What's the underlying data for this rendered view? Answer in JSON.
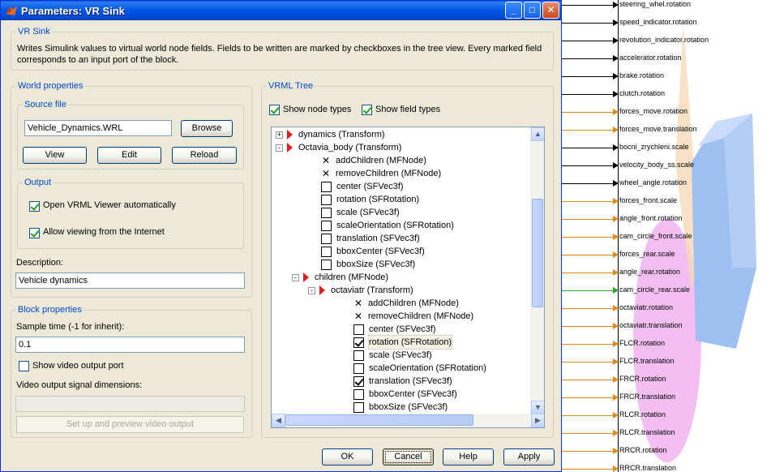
{
  "window": {
    "title": "Parameters: VR Sink",
    "minimize_label": "_",
    "maximize_label": "□",
    "close_label": "✕"
  },
  "vr_sink": {
    "heading": "VR Sink",
    "description": "Writes Simulink values to virtual world node fields. Fields to be written are marked by checkboxes in the tree view. Every marked field corresponds to an input port of the block."
  },
  "world_properties": {
    "heading": "World properties",
    "source_file": {
      "heading": "Source file",
      "value": "Vehicle_Dynamics.WRL",
      "browse_label": "Browse",
      "view_label": "View",
      "edit_label": "Edit",
      "reload_label": "Reload"
    },
    "output": {
      "heading": "Output",
      "open_viewer_label": "Open VRML Viewer automatically",
      "open_viewer_checked": true,
      "allow_internet_label": "Allow viewing from the Internet",
      "allow_internet_checked": true
    },
    "description_label": "Description:",
    "description_value": "Vehicle dynamics"
  },
  "block_properties": {
    "heading": "Block properties",
    "sample_time_label": "Sample time (-1 for inherit):",
    "sample_time_value": "0.1",
    "show_video_label": "Show video output port",
    "show_video_checked": false,
    "video_dims_label": "Video output signal dimensions:",
    "video_dims_value": "",
    "setup_video_label": "Set up and preview video output"
  },
  "vrml_tree": {
    "heading": "VRML Tree",
    "show_node_types_label": "Show node types",
    "show_node_types_checked": true,
    "show_field_types_label": "Show field types",
    "show_field_types_checked": true,
    "rows": [
      {
        "label": "dynamics (Transform)",
        "kind": "node",
        "level": 0,
        "expander": "+"
      },
      {
        "label": "Octavia_body (Transform)",
        "kind": "node",
        "level": 0,
        "expander": "-"
      },
      {
        "label": "addChildren (MFNode)",
        "kind": "x",
        "level": 1
      },
      {
        "label": "removeChildren (MFNode)",
        "kind": "x",
        "level": 1
      },
      {
        "label": "center (SFVec3f)",
        "kind": "cb",
        "level": 1,
        "checked": false
      },
      {
        "label": "rotation (SFRotation)",
        "kind": "cb",
        "level": 1,
        "checked": false
      },
      {
        "label": "scale (SFVec3f)",
        "kind": "cb",
        "level": 1,
        "checked": false
      },
      {
        "label": "scaleOrientation (SFRotation)",
        "kind": "cb",
        "level": 1,
        "checked": false
      },
      {
        "label": "translation (SFVec3f)",
        "kind": "cb",
        "level": 1,
        "checked": false
      },
      {
        "label": "bboxCenter (SFVec3f)",
        "kind": "cb",
        "level": 1,
        "checked": false
      },
      {
        "label": "bboxSize (SFVec3f)",
        "kind": "cb",
        "level": 1,
        "checked": false
      },
      {
        "label": "children (MFNode)",
        "kind": "node",
        "level": 1,
        "expander": "-"
      },
      {
        "label": "octaviatr (Transform)",
        "kind": "node",
        "level": 2,
        "expander": "-"
      },
      {
        "label": "addChildren (MFNode)",
        "kind": "x",
        "level": 3
      },
      {
        "label": "removeChildren (MFNode)",
        "kind": "x",
        "level": 3
      },
      {
        "label": "center (SFVec3f)",
        "kind": "cb",
        "level": 3,
        "checked": false
      },
      {
        "label": "rotation (SFRotation)",
        "kind": "cb",
        "level": 3,
        "checked": true,
        "selected": true
      },
      {
        "label": "scale (SFVec3f)",
        "kind": "cb",
        "level": 3,
        "checked": false
      },
      {
        "label": "scaleOrientation (SFRotation)",
        "kind": "cb",
        "level": 3,
        "checked": false
      },
      {
        "label": "translation (SFVec3f)",
        "kind": "cb",
        "level": 3,
        "checked": true
      },
      {
        "label": "bboxCenter (SFVec3f)",
        "kind": "cb",
        "level": 3,
        "checked": false
      },
      {
        "label": "bboxSize (SFVec3f)",
        "kind": "cb",
        "level": 3,
        "checked": false
      }
    ]
  },
  "buttons": {
    "ok": "OK",
    "cancel": "Cancel",
    "help": "Help",
    "apply": "Apply"
  },
  "simulink_ports": [
    {
      "label": "steering_whel.rotation",
      "color": "#000000"
    },
    {
      "label": "speed_indicator.rotation",
      "color": "#000000"
    },
    {
      "label": "revolution_indicator.rotation",
      "color": "#000000"
    },
    {
      "label": "accelerator.rotation",
      "color": "#000000"
    },
    {
      "label": "brake.rotation",
      "color": "#000000"
    },
    {
      "label": "clutch.rotation",
      "color": "#000000"
    },
    {
      "label": "forces_move.rotation",
      "color": "#e08a1a"
    },
    {
      "label": "forces_move.translation",
      "color": "#e08a1a"
    },
    {
      "label": "bocni_zrychleni.scale",
      "color": "#000000"
    },
    {
      "label": "velocity_body_ss.scale",
      "color": "#000000"
    },
    {
      "label": "wheel_angle.rotation",
      "color": "#000000"
    },
    {
      "label": "forces_front.scale",
      "color": "#e08a1a"
    },
    {
      "label": "angle_front.rotation",
      "color": "#e08a1a"
    },
    {
      "label": "cam_circle_front.scale",
      "color": "#e08a1a"
    },
    {
      "label": "forces_rear.scale",
      "color": "#e08a1a"
    },
    {
      "label": "angle_rear.rotation",
      "color": "#e08a1a"
    },
    {
      "label": "cam_circle_rear.scale",
      "color": "#2aa52a"
    },
    {
      "label": "octaviatr.rotation",
      "color": "#e08a1a"
    },
    {
      "label": "octaviatr.translation",
      "color": "#e08a1a"
    },
    {
      "label": "FLCR.rotation",
      "color": "#e08a1a"
    },
    {
      "label": "FLCR.translation",
      "color": "#e08a1a"
    },
    {
      "label": "FRCR.rotation",
      "color": "#e08a1a"
    },
    {
      "label": "FRCR.translation",
      "color": "#e08a1a"
    },
    {
      "label": "RLCR.rotation",
      "color": "#e08a1a"
    },
    {
      "label": "RLCR.translation",
      "color": "#e08a1a"
    },
    {
      "label": "RRCR.rotation",
      "color": "#e08a1a"
    },
    {
      "label": "RRCR.translation",
      "color": "#e08a1a"
    }
  ]
}
